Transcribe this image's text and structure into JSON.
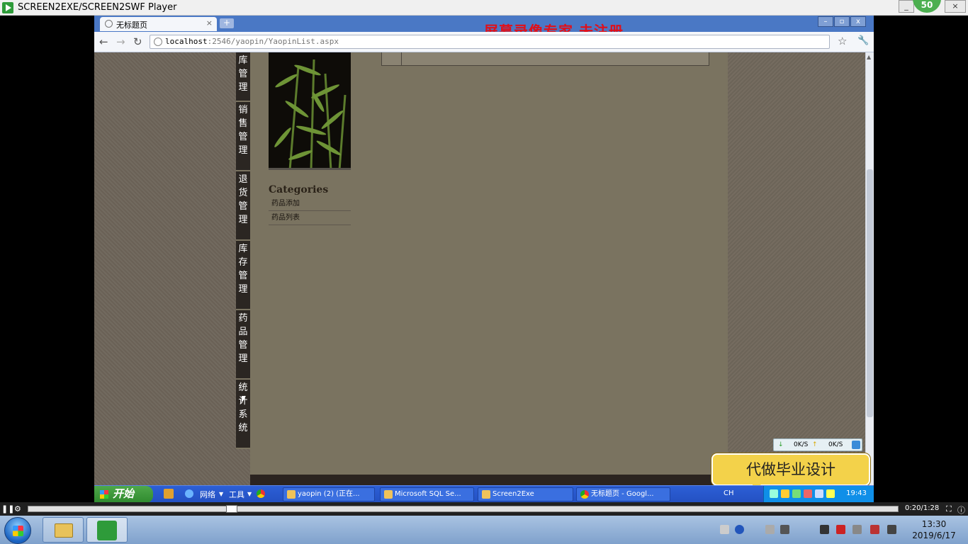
{
  "player": {
    "title": "SCREEN2EXE/SCREEN2SWF Player",
    "badge": "50",
    "minimize": "_",
    "maximize": "□",
    "close": "×"
  },
  "browser": {
    "tab_title": "无标题页",
    "tab_close": "×",
    "new_tab": "+",
    "watermark": "屏幕录像专家  未注册",
    "url_host": "localhost",
    "url_rest": ":2546/yaopin/YaopinList.aspx",
    "win_min": "–",
    "win_max": "▫",
    "win_close": "x"
  },
  "page": {
    "nav": [
      {
        "label": "库\n管\n理"
      },
      {
        "label": "销\n售\n管\n理"
      },
      {
        "label": "退\n货\n管\n理"
      },
      {
        "label": "库\n存\n管\n理"
      },
      {
        "label": "药\n品\n管\n理"
      },
      {
        "label": "统\n计\n系\n统"
      }
    ],
    "categories_title": "Categories",
    "categories": [
      "药品添加",
      "药品列表"
    ]
  },
  "netmon": {
    "down": "0K/S",
    "up": "0K/S"
  },
  "ad": "代做毕业设计",
  "xp_taskbar": {
    "start": "开始",
    "quicklaunch": [
      "网络",
      "工具"
    ],
    "tasks": [
      "yaopin (2) (正在...",
      "Microsoft SQL Se...",
      "Screen2Exe",
      "无标题页 - Googl..."
    ],
    "lang": "CH",
    "clock": "19:43"
  },
  "progress": {
    "time": "0:20/1:28",
    "played_fraction": 0.23
  },
  "win7": {
    "time": "13:30",
    "date": "2019/6/17"
  },
  "colors": {
    "xp_blue": "#2451c2",
    "chrome_blue": "#4a78c5",
    "watermark_red": "#e0101a",
    "ad_yellow": "#f3d24a"
  }
}
